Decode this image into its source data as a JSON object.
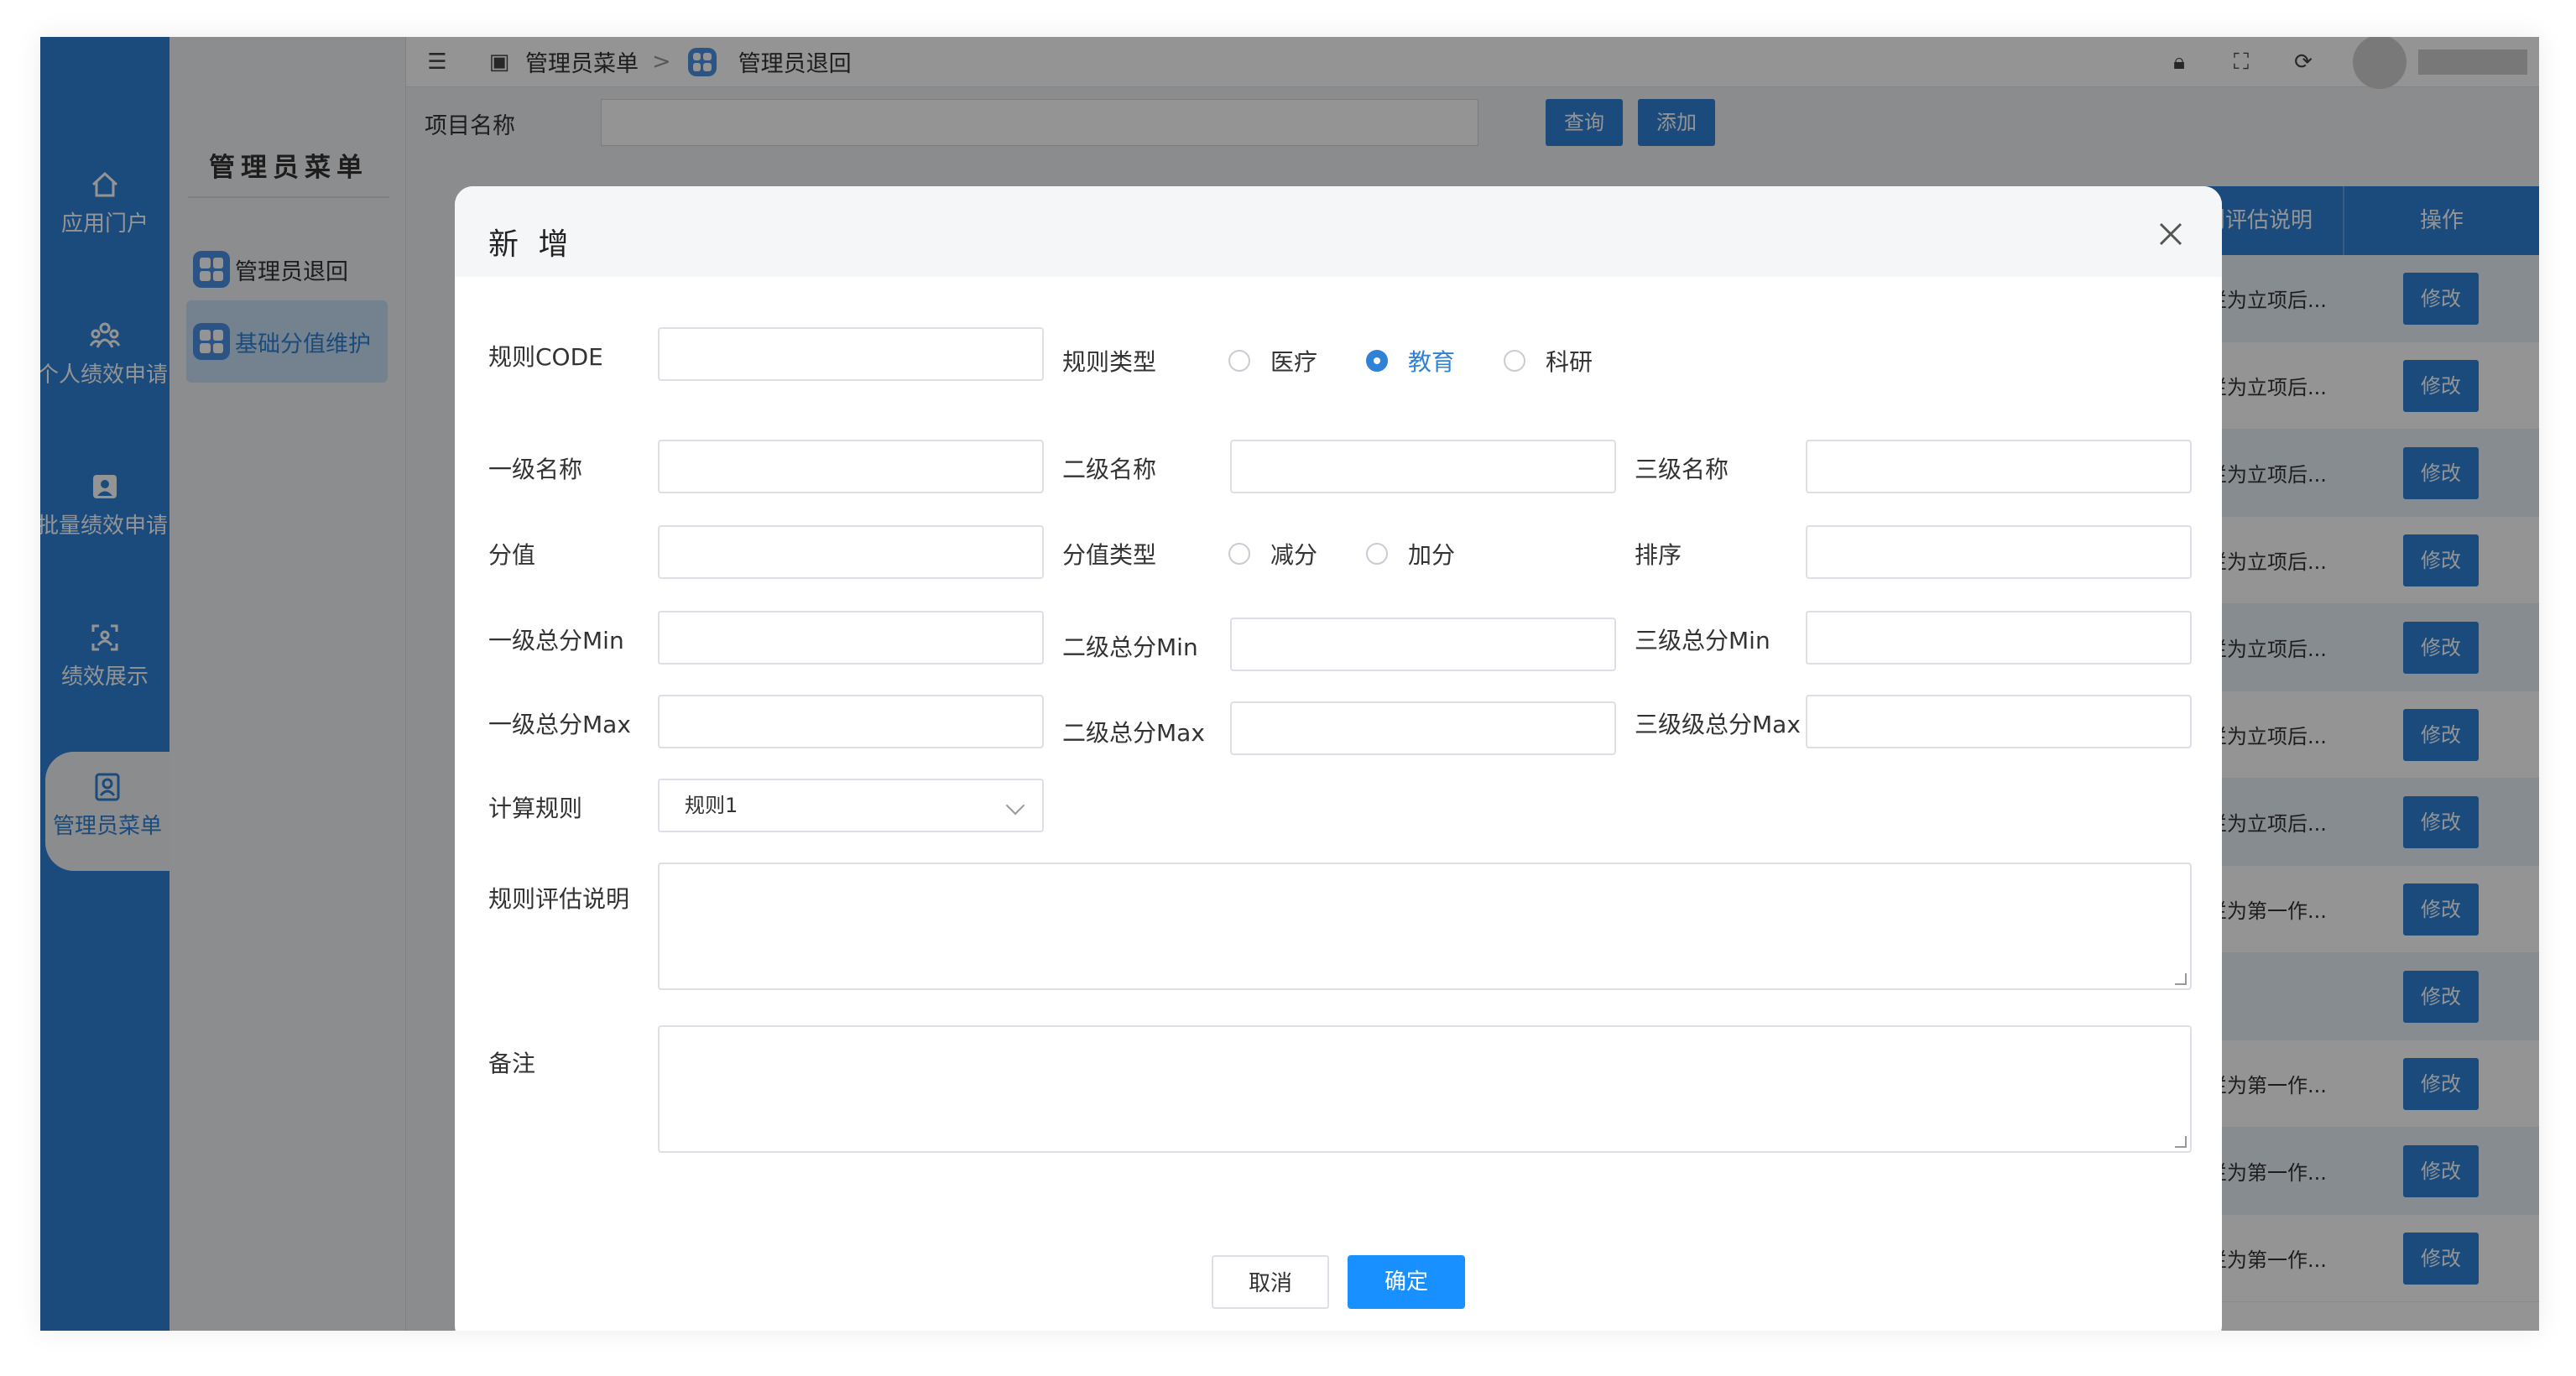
{
  "nav": {
    "items": [
      {
        "label": "应用门户",
        "icon": "home-icon"
      },
      {
        "label": "个人绩效申请",
        "icon": "people-icon"
      },
      {
        "label": "批量绩效申请",
        "icon": "user-card-icon"
      },
      {
        "label": "绩效展示",
        "icon": "scan-icon"
      },
      {
        "label": "管理员菜单",
        "icon": "admin-icon",
        "active": true
      }
    ]
  },
  "subnav": {
    "title": "管理员菜单",
    "items": [
      {
        "label": "管理员退回"
      },
      {
        "label": "基础分值维护",
        "active": true
      }
    ]
  },
  "breadcrumb": {
    "root": "管理员菜单",
    "separator": ">",
    "current": "管理员退回"
  },
  "search": {
    "label": "项目名称",
    "query_button": "查询",
    "add_button": "添加"
  },
  "table": {
    "headers": [
      "规则评估说明",
      "操作"
    ],
    "rows": [
      {
        "desc": "值栏为立项后...",
        "action": "修改"
      },
      {
        "desc": "值栏为立项后...",
        "action": "修改"
      },
      {
        "desc": "值栏为立项后...",
        "action": "修改"
      },
      {
        "desc": "值栏为立项后...",
        "action": "修改"
      },
      {
        "desc": "值栏为立项后...",
        "action": "修改"
      },
      {
        "desc": "值栏为立项后...",
        "action": "修改"
      },
      {
        "desc": "值栏为立项后...",
        "action": "修改"
      },
      {
        "desc": "值栏为第一作...",
        "action": "修改"
      },
      {
        "desc": "",
        "action": "修改"
      },
      {
        "desc": "值栏为第一作...",
        "action": "修改"
      },
      {
        "desc": "值栏为第一作...",
        "action": "修改"
      },
      {
        "desc": "值栏为第一作...",
        "action": "修改"
      }
    ]
  },
  "dialog": {
    "title": "新 增",
    "fields": {
      "rule_code": "规则CODE",
      "rule_type": "规则类型",
      "rule_type_options": [
        "医疗",
        "教育",
        "科研"
      ],
      "rule_type_selected": "教育",
      "level1_name": "一级名称",
      "level2_name": "二级名称",
      "level3_name": "三级名称",
      "score": "分值",
      "score_type": "分值类型",
      "score_type_options": [
        "减分",
        "加分"
      ],
      "sort": "排序",
      "level1_min": "一级总分Min",
      "level2_min": "二级总分Min",
      "level3_min": "三级总分Min",
      "level1_max": "一级总分Max",
      "level2_max": "二级总分Max",
      "level3_max": "三级级总分Max",
      "calc_rule": "计算规则",
      "calc_rule_value": "规则1",
      "rule_desc": "规则评估说明",
      "remark": "备注"
    },
    "cancel_label": "取消",
    "ok_label": "确定"
  },
  "colors": {
    "primary": "#2f82d6",
    "button_primary": "#1890ff"
  }
}
